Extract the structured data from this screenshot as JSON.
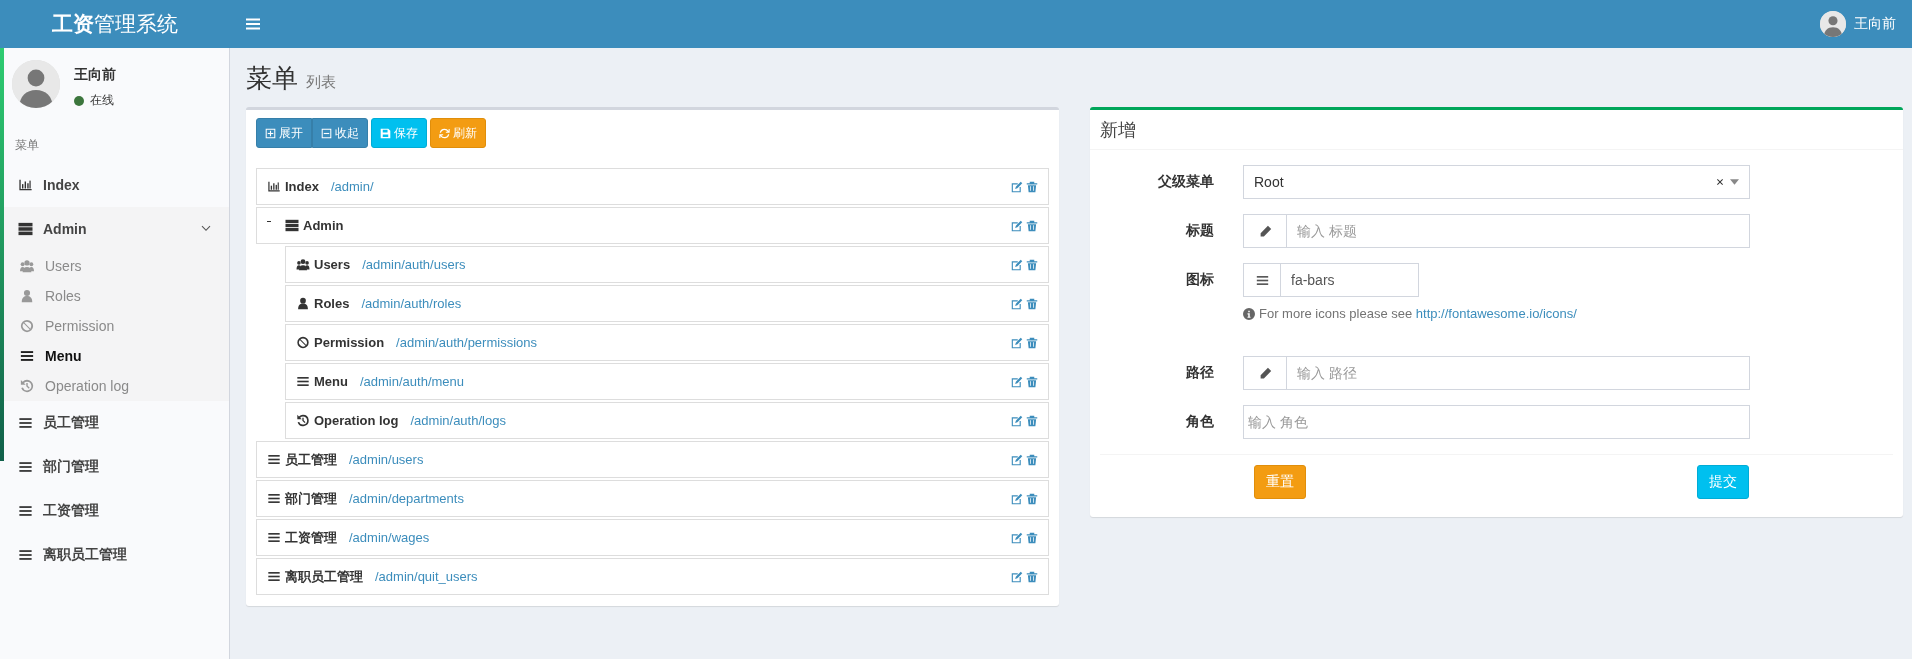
{
  "header": {
    "brand": "**工资**管理系统",
    "user_name": "王向前"
  },
  "sidebar": {
    "user": {
      "name": "王向前",
      "status": "在线"
    },
    "section_label": "菜单",
    "items": [
      {
        "label": "Index",
        "kind": "chart",
        "selected": false
      },
      {
        "label": "Admin",
        "kind": "server",
        "selected": false,
        "expanded": true,
        "children": [
          {
            "label": "Users",
            "kind": "users",
            "selected": false
          },
          {
            "label": "Roles",
            "kind": "user",
            "selected": false
          },
          {
            "label": "Permission",
            "kind": "ban",
            "selected": false
          },
          {
            "label": "Menu",
            "kind": "bars",
            "selected": true
          },
          {
            "label": "Operation log",
            "kind": "history",
            "selected": false
          }
        ]
      },
      {
        "label": "员工管理",
        "kind": "bars",
        "selected": false
      },
      {
        "label": "部门管理",
        "kind": "bars",
        "selected": false
      },
      {
        "label": "工资管理",
        "kind": "bars",
        "selected": false
      },
      {
        "label": "离职员工管理",
        "kind": "bars",
        "selected": false
      }
    ]
  },
  "page": {
    "title": "菜单",
    "subtitle": "列表"
  },
  "toolbar": {
    "group": [
      {
        "label": "展开",
        "kind": "expand"
      },
      {
        "label": "收起",
        "kind": "collapse"
      }
    ],
    "buttons": [
      {
        "label": "保存",
        "kind": "save"
      },
      {
        "label": "刷新",
        "kind": "refresh"
      }
    ]
  },
  "tree": [
    {
      "title": "Index",
      "uri": "/admin/",
      "kind": "chart"
    },
    {
      "title": "Admin",
      "kind": "server",
      "expanded": true,
      "children": [
        {
          "title": "Users",
          "uri": "/admin/auth/users",
          "kind": "users"
        },
        {
          "title": "Roles",
          "uri": "/admin/auth/roles",
          "kind": "user"
        },
        {
          "title": "Permission",
          "uri": "/admin/auth/permissions",
          "kind": "ban"
        },
        {
          "title": "Menu",
          "uri": "/admin/auth/menu",
          "kind": "bars"
        },
        {
          "title": "Operation log",
          "uri": "/admin/auth/logs",
          "kind": "history"
        }
      ]
    },
    {
      "title": "员工管理",
      "uri": "/admin/users",
      "kind": "bars"
    },
    {
      "title": "部门管理",
      "uri": "/admin/departments",
      "kind": "bars"
    },
    {
      "title": "工资管理",
      "uri": "/admin/wages",
      "kind": "bars"
    },
    {
      "title": "离职员工管理",
      "uri": "/admin/quit_users",
      "kind": "bars"
    }
  ],
  "form": {
    "title": "新增",
    "fields": [
      {
        "label": "父级菜单",
        "kind": "select",
        "value": "Root"
      },
      {
        "label": "标题",
        "kind": "addon",
        "placeholder": "输入 标题"
      },
      {
        "label": "图标",
        "kind": "icon-picker",
        "value": "fa-bars",
        "help_text": "For more icons please see ",
        "help_link": "http://fontawesome.io/icons/"
      },
      {
        "label": "路径",
        "kind": "addon",
        "placeholder": "输入 路径"
      },
      {
        "label": "角色",
        "kind": "plain",
        "placeholder": "输入 角色"
      }
    ],
    "buttons": [
      {
        "label": "重置",
        "kind": "reset"
      },
      {
        "label": "提交",
        "kind": "submit"
      }
    ]
  }
}
